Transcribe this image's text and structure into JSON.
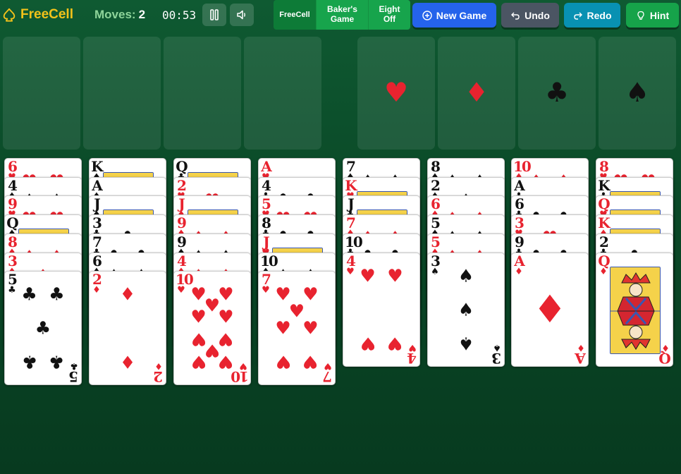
{
  "header": {
    "title": "FreeCell",
    "moves_label": "Moves:",
    "moves_value": "2",
    "timer": "00:53"
  },
  "modes": [
    "FreeCell",
    "Baker's\nGame",
    "Eight\nOff"
  ],
  "buttons": {
    "new_game": "New Game",
    "undo": "Undo",
    "redo": "Redo",
    "hint": "Hint"
  },
  "colors": {
    "table": "#0a4827",
    "logo": "#f2c21a",
    "red": "#e8232f",
    "new_game": "#2563eb",
    "undo": "#4b5563",
    "redo": "#0891b2",
    "hint": "#16a34a"
  },
  "free_cells": [
    null,
    null,
    null,
    null
  ],
  "foundations": [
    {
      "suit": "hearts",
      "symbol": "♥",
      "cards": []
    },
    {
      "suit": "diamonds",
      "symbol": "♦",
      "cards": []
    },
    {
      "suit": "clubs",
      "symbol": "♣",
      "cards": []
    },
    {
      "suit": "spades",
      "symbol": "♠",
      "cards": []
    }
  ],
  "tableau": [
    [
      [
        "6",
        "♥"
      ],
      [
        "4",
        "♠"
      ],
      [
        "9",
        "♥"
      ],
      [
        "Q",
        "♠"
      ],
      [
        "8",
        "♦"
      ],
      [
        "3",
        "♦"
      ],
      [
        "5",
        "♣"
      ]
    ],
    [
      [
        "K",
        "♠"
      ],
      [
        "A",
        "♠"
      ],
      [
        "J",
        "♠"
      ],
      [
        "3",
        "♣"
      ],
      [
        "7",
        "♣"
      ],
      [
        "6",
        "♠"
      ],
      [
        "2",
        "♦"
      ]
    ],
    [
      [
        "Q",
        "♣"
      ],
      [
        "2",
        "♥"
      ],
      [
        "J",
        "♦"
      ],
      [
        "9",
        "♦"
      ],
      [
        "9",
        "♠"
      ],
      [
        "4",
        "♦"
      ],
      [
        "10",
        "♥"
      ]
    ],
    [
      [
        "A",
        "♥"
      ],
      [
        "4",
        "♣"
      ],
      [
        "5",
        "♥"
      ],
      [
        "8",
        "♣"
      ],
      [
        "J",
        "♥"
      ],
      [
        "10",
        "♠"
      ],
      [
        "7",
        "♥"
      ]
    ],
    [
      [
        "7",
        "♠"
      ],
      [
        "K",
        "♥"
      ],
      [
        "J",
        "♣"
      ],
      [
        "7",
        "♦"
      ],
      [
        "10",
        "♣"
      ],
      [
        "4",
        "♥"
      ]
    ],
    [
      [
        "8",
        "♠"
      ],
      [
        "2",
        "♠"
      ],
      [
        "6",
        "♦"
      ],
      [
        "5",
        "♠"
      ],
      [
        "5",
        "♦"
      ],
      [
        "3",
        "♠"
      ]
    ],
    [
      [
        "10",
        "♦"
      ],
      [
        "A",
        "♣"
      ],
      [
        "6",
        "♣"
      ],
      [
        "3",
        "♥"
      ],
      [
        "9",
        "♣"
      ],
      [
        "A",
        "♦"
      ]
    ],
    [
      [
        "8",
        "♥"
      ],
      [
        "K",
        "♣"
      ],
      [
        "Q",
        "♥"
      ],
      [
        "K",
        "♦"
      ],
      [
        "2",
        "♣"
      ],
      [
        "Q",
        "♦"
      ]
    ]
  ]
}
